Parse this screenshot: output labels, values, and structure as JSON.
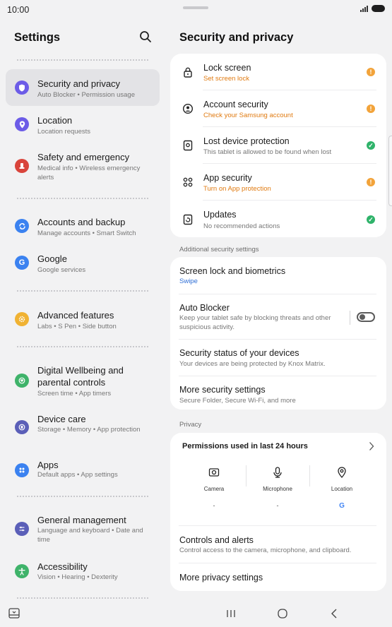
{
  "status_bar": {
    "time": "10:00"
  },
  "left": {
    "title": "Settings",
    "items": [
      {
        "title": "Security and privacy",
        "subtitle": "Auto Blocker • Permission usage",
        "icon": "shield-icon",
        "color": "#6c5ce7"
      },
      {
        "title": "Location",
        "subtitle": "Location requests",
        "icon": "location-pin-icon",
        "color": "#6c5ce7"
      },
      {
        "title": "Safety and emergency",
        "subtitle": "Medical info • Wireless emergency alerts",
        "icon": "emergency-icon",
        "color": "#d9443b"
      },
      {
        "title": "Accounts and backup",
        "subtitle": "Manage accounts • Smart Switch",
        "icon": "sync-icon",
        "color": "#3b82f0"
      },
      {
        "title": "Google",
        "subtitle": "Google services",
        "icon": "google-icon",
        "color": "#3b82f0"
      },
      {
        "title": "Advanced features",
        "subtitle": "Labs • S Pen • Side button",
        "icon": "gear-star-icon",
        "color": "#f0b232"
      },
      {
        "title": "Digital Wellbeing and parental controls",
        "subtitle": "Screen time • App timers",
        "icon": "heart-icon",
        "color": "#3fb36a"
      },
      {
        "title": "Device care",
        "subtitle": "Storage • Memory • App protection",
        "icon": "device-care-icon",
        "color": "#5b5fb8"
      },
      {
        "title": "Apps",
        "subtitle": "Default apps • App settings",
        "icon": "apps-grid-icon",
        "color": "#3b82f0"
      },
      {
        "title": "General management",
        "subtitle": "Language and keyboard • Date and time",
        "icon": "sliders-icon",
        "color": "#5b5fb8"
      },
      {
        "title": "Accessibility",
        "subtitle": "Vision • Hearing • Dexterity",
        "icon": "accessibility-icon",
        "color": "#3fb36a"
      }
    ]
  },
  "right": {
    "title": "Security and privacy",
    "status_items": [
      {
        "title": "Lock screen",
        "subtitle": "Set screen lock",
        "state": "warning",
        "icon": "padlock-icon"
      },
      {
        "title": "Account security",
        "subtitle": "Check your Samsung account",
        "state": "warning",
        "icon": "account-icon"
      },
      {
        "title": "Lost device protection",
        "subtitle": "This tablet is allowed to be found when lost",
        "state": "ok",
        "icon": "lost-device-icon"
      },
      {
        "title": "App security",
        "subtitle": "Turn on App protection",
        "state": "warning",
        "icon": "app-security-icon"
      },
      {
        "title": "Updates",
        "subtitle": "No recommended actions",
        "state": "ok",
        "icon": "update-icon"
      }
    ],
    "additional_label": "Additional security settings",
    "screen_lock": {
      "title": "Screen lock and biometrics",
      "subtitle": "Swipe"
    },
    "auto_blocker": {
      "title": "Auto Blocker",
      "subtitle": "Keep your tablet safe by blocking threats and other suspicious activity.",
      "enabled": false
    },
    "security_status": {
      "title": "Security status of your devices",
      "subtitle": "Your devices are being protected by Knox Matrix."
    },
    "more_security": {
      "title": "More security settings",
      "subtitle": "Secure Folder, Secure Wi-Fi, and more"
    },
    "privacy_label": "Privacy",
    "permissions": {
      "title": "Permissions used in last 24 hours",
      "columns": [
        {
          "label": "Camera",
          "value": "-"
        },
        {
          "label": "Microphone",
          "value": "-"
        },
        {
          "label": "Location",
          "value": ""
        }
      ]
    },
    "controls": {
      "title": "Controls and alerts",
      "subtitle": "Control access to the camera, microphone, and clipboard."
    },
    "more_privacy": {
      "title": "More privacy settings"
    }
  }
}
